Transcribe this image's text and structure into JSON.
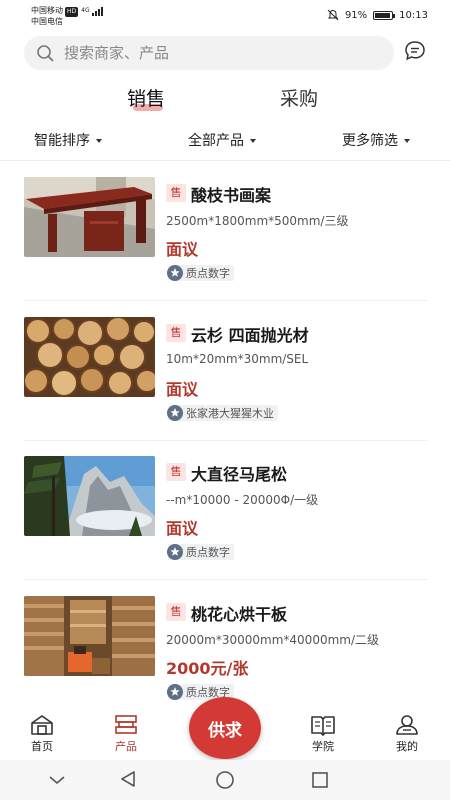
{
  "status_bar": {
    "carrier1": "中国移动",
    "hd": "HD",
    "network": "4G",
    "carrier2": "中国电信",
    "battery": "91%",
    "time": "10:13"
  },
  "search": {
    "placeholder": "搜索商家、产品"
  },
  "main_tabs": [
    {
      "label": "销售",
      "active": true
    },
    {
      "label": "采购",
      "active": false
    }
  ],
  "filters": [
    {
      "label": "智能排序"
    },
    {
      "label": "全部产品"
    },
    {
      "label": "更多筛选"
    }
  ],
  "products": [
    {
      "badge": "售",
      "title": "酸枝书画案",
      "spec": "2500m*1800mm*500mm/三级",
      "price": "面议",
      "company": "质点数字",
      "image": "rosewood-table"
    },
    {
      "badge": "售",
      "title": "云杉 四面抛光材",
      "spec": "10m*20mm*30mm/SEL",
      "price": "面议",
      "company": "张家港大猩猩木业",
      "image": "log-pile"
    },
    {
      "badge": "售",
      "title": "大直径马尾松",
      "spec": "--m*10000 - 20000Φ/一级",
      "price": "面议",
      "company": "质点数字",
      "image": "pine-mountain"
    },
    {
      "badge": "售",
      "title": "桃花心烘干板",
      "spec": "20000m*30000mm*40000mm/二级",
      "price": "2000元/张",
      "company": "质点数字",
      "image": "lumber-warehouse"
    }
  ],
  "bottom_nav": {
    "home": "首页",
    "products": "产品",
    "fab": "供求",
    "school": "学院",
    "mine": "我的"
  },
  "colors": {
    "accent": "#b03a2e",
    "fab": "#d33a35",
    "badge_bg": "#fde3e3"
  }
}
